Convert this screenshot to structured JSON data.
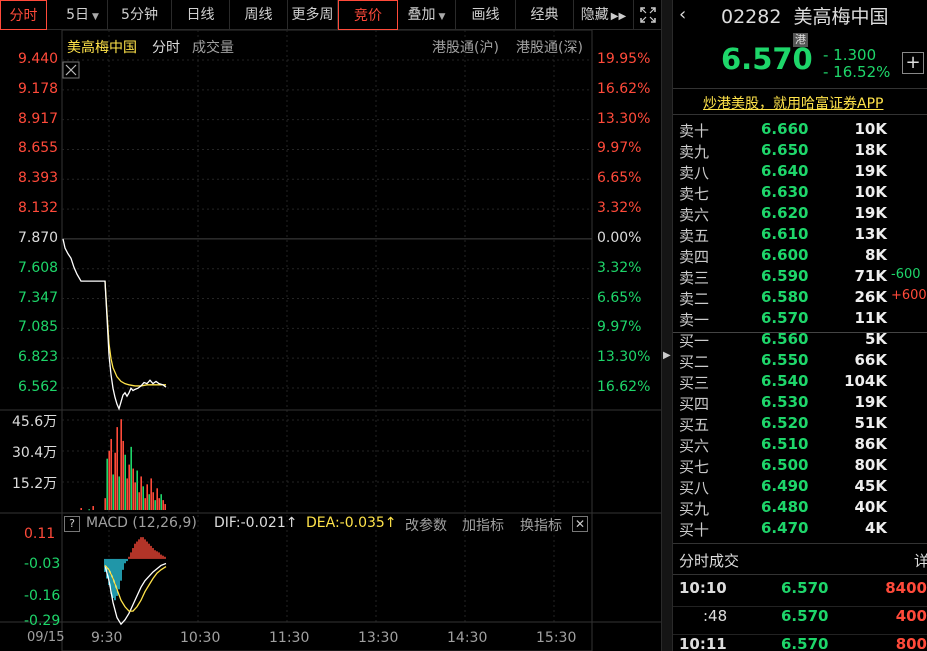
{
  "toolbar": {
    "tabs": [
      "分时",
      "5日",
      "5分钟",
      "日线",
      "周线",
      "更多周"
    ],
    "bidding": "竞价",
    "overlay": "叠加",
    "draw": "画线",
    "classic": "经典",
    "hide": "隐藏"
  },
  "chart": {
    "stock_name": "美高梅中国",
    "mode_label": "分时",
    "volume_label": "成交量",
    "connect_sh": "港股通(沪)",
    "connect_sz": "港股通(深)",
    "date": "09/15",
    "time_ticks": [
      "9:30",
      "10:30",
      "11:30",
      "13:30",
      "14:30",
      "15:30"
    ],
    "price_ticks": [
      "9.440",
      "9.178",
      "8.917",
      "8.655",
      "8.393",
      "8.132",
      "7.870",
      "7.608",
      "7.347",
      "7.085",
      "6.823",
      "6.562"
    ],
    "pct_ticks": [
      "19.95%",
      "16.62%",
      "13.30%",
      "9.97%",
      "6.65%",
      "3.32%",
      "0.00%",
      "3.32%",
      "6.65%",
      "9.97%",
      "13.30%",
      "16.62%"
    ],
    "volume_ticks": [
      "45.6万",
      "30.4万",
      "15.2万"
    ],
    "macd_label": "MACD (12,26,9)",
    "dif": "DIF:-0.021↑",
    "dea": "DEA:-0.035↑",
    "params": "改参数",
    "add_indicator": "加指标",
    "switch_indicator": "换指标",
    "macd_ticks": [
      "0.11",
      "-0.03",
      "-0.16",
      "-0.29"
    ]
  },
  "chart_data": {
    "type": "line",
    "price_line": [
      [
        0,
        7.87
      ],
      [
        2,
        7.79
      ],
      [
        5,
        7.74
      ],
      [
        8,
        7.7
      ],
      [
        11,
        7.62
      ],
      [
        14,
        7.56
      ],
      [
        18,
        7.5
      ],
      [
        22,
        7.5
      ],
      [
        26,
        7.5
      ],
      [
        30,
        7.5
      ],
      [
        34,
        7.5
      ],
      [
        38,
        7.5
      ],
      [
        42,
        7.5
      ],
      [
        44,
        7.18
      ],
      [
        46,
        6.85
      ],
      [
        48,
        6.68
      ],
      [
        50,
        6.56
      ],
      [
        52,
        6.48
      ],
      [
        54,
        6.42
      ],
      [
        56,
        6.38
      ],
      [
        58,
        6.44
      ],
      [
        60,
        6.5
      ],
      [
        62,
        6.52
      ],
      [
        64,
        6.49
      ],
      [
        66,
        6.52
      ],
      [
        68,
        6.56
      ],
      [
        70,
        6.54
      ],
      [
        72,
        6.55
      ],
      [
        75,
        6.56
      ],
      [
        78,
        6.58
      ],
      [
        81,
        6.61
      ],
      [
        84,
        6.6
      ],
      [
        87,
        6.63
      ],
      [
        90,
        6.6
      ],
      [
        93,
        6.62
      ],
      [
        96,
        6.6
      ],
      [
        100,
        6.59
      ],
      [
        103,
        6.57
      ]
    ],
    "avg_line": [
      [
        42,
        7.5
      ],
      [
        44,
        7.22
      ],
      [
        46,
        6.95
      ],
      [
        48,
        6.82
      ],
      [
        50,
        6.74
      ],
      [
        54,
        6.66
      ],
      [
        58,
        6.62
      ],
      [
        62,
        6.6
      ],
      [
        66,
        6.59
      ],
      [
        72,
        6.58
      ],
      [
        78,
        6.58
      ],
      [
        84,
        6.59
      ],
      [
        90,
        6.59
      ],
      [
        96,
        6.59
      ],
      [
        103,
        6.59
      ]
    ],
    "volumes": [
      [
        18,
        0.1
      ],
      [
        26,
        0.04
      ],
      [
        30,
        0.2
      ],
      [
        42,
        0.6
      ],
      [
        44,
        2.6
      ],
      [
        46,
        3.0
      ],
      [
        48,
        3.6
      ],
      [
        50,
        1.8
      ],
      [
        52,
        2.9
      ],
      [
        54,
        4.2
      ],
      [
        56,
        1.7
      ],
      [
        58,
        4.6
      ],
      [
        60,
        3.5
      ],
      [
        62,
        2.8
      ],
      [
        64,
        1.6
      ],
      [
        66,
        2.3
      ],
      [
        68,
        3.2
      ],
      [
        70,
        2.1
      ],
      [
        72,
        1.4
      ],
      [
        74,
        2.0
      ],
      [
        76,
        0.9
      ],
      [
        78,
        1.7
      ],
      [
        80,
        1.2
      ],
      [
        82,
        0.6
      ],
      [
        84,
        1.3
      ],
      [
        86,
        0.8
      ],
      [
        88,
        1.6
      ],
      [
        90,
        0.9
      ],
      [
        92,
        0.5
      ],
      [
        94,
        1.1
      ],
      [
        96,
        0.6
      ],
      [
        98,
        0.8
      ],
      [
        100,
        0.5
      ],
      [
        102,
        0.3
      ]
    ],
    "macd_bars": [
      [
        42,
        -0.06
      ],
      [
        44,
        -0.09
      ],
      [
        46,
        -0.12
      ],
      [
        48,
        -0.16
      ],
      [
        50,
        -0.18
      ],
      [
        52,
        -0.19
      ],
      [
        54,
        -0.17
      ],
      [
        56,
        -0.14
      ],
      [
        58,
        -0.1
      ],
      [
        60,
        -0.05
      ],
      [
        62,
        -0.02
      ],
      [
        64,
        -0.01
      ],
      [
        66,
        0.01
      ],
      [
        68,
        0.03
      ],
      [
        70,
        0.05
      ],
      [
        72,
        0.07
      ],
      [
        74,
        0.08
      ],
      [
        76,
        0.09
      ],
      [
        78,
        0.1
      ],
      [
        80,
        0.1
      ],
      [
        82,
        0.09
      ],
      [
        84,
        0.08
      ],
      [
        86,
        0.07
      ],
      [
        88,
        0.06
      ],
      [
        90,
        0.05
      ],
      [
        92,
        0.04
      ],
      [
        94,
        0.035
      ],
      [
        96,
        0.03
      ],
      [
        98,
        0.02
      ],
      [
        100,
        0.015
      ],
      [
        102,
        0.01
      ]
    ],
    "dif_line": [
      [
        42,
        -0.03
      ],
      [
        46,
        -0.1
      ],
      [
        50,
        -0.2
      ],
      [
        54,
        -0.27
      ],
      [
        58,
        -0.3
      ],
      [
        62,
        -0.28
      ],
      [
        66,
        -0.25
      ],
      [
        70,
        -0.21
      ],
      [
        74,
        -0.17
      ],
      [
        78,
        -0.13
      ],
      [
        82,
        -0.1
      ],
      [
        86,
        -0.08
      ],
      [
        90,
        -0.06
      ],
      [
        94,
        -0.045
      ],
      [
        98,
        -0.03
      ],
      [
        103,
        -0.021
      ]
    ],
    "dea_line": [
      [
        42,
        -0.03
      ],
      [
        46,
        -0.05
      ],
      [
        50,
        -0.09
      ],
      [
        54,
        -0.14
      ],
      [
        58,
        -0.19
      ],
      [
        62,
        -0.22
      ],
      [
        66,
        -0.24
      ],
      [
        70,
        -0.24
      ],
      [
        74,
        -0.22
      ],
      [
        78,
        -0.19
      ],
      [
        82,
        -0.15
      ],
      [
        86,
        -0.12
      ],
      [
        90,
        -0.09
      ],
      [
        94,
        -0.065
      ],
      [
        98,
        -0.05
      ],
      [
        103,
        -0.035
      ]
    ],
    "price_range": [
      6.562,
      9.44
    ],
    "volume_max": 4.56,
    "macd_range": [
      -0.29,
      0.11
    ]
  },
  "quote": {
    "code": "02282",
    "name": "美高梅中国",
    "market_badge": "港",
    "price": "6.570",
    "change": "- 1.300",
    "change_pct": "- 16.52%",
    "plus": "+",
    "ad": "炒港美股，就用哈富证券APP"
  },
  "orderbook": {
    "asks": [
      {
        "label": "卖十",
        "price": "6.660",
        "vol": "10K",
        "delta": ""
      },
      {
        "label": "卖九",
        "price": "6.650",
        "vol": "18K",
        "delta": ""
      },
      {
        "label": "卖八",
        "price": "6.640",
        "vol": "19K",
        "delta": ""
      },
      {
        "label": "卖七",
        "price": "6.630",
        "vol": "10K",
        "delta": ""
      },
      {
        "label": "卖六",
        "price": "6.620",
        "vol": "19K",
        "delta": ""
      },
      {
        "label": "卖五",
        "price": "6.610",
        "vol": "13K",
        "delta": ""
      },
      {
        "label": "卖四",
        "price": "6.600",
        "vol": "8K",
        "delta": ""
      },
      {
        "label": "卖三",
        "price": "6.590",
        "vol": "71K",
        "delta": "-600"
      },
      {
        "label": "卖二",
        "price": "6.580",
        "vol": "26K",
        "delta": "+600"
      },
      {
        "label": "卖一",
        "price": "6.570",
        "vol": "11K",
        "delta": ""
      }
    ],
    "bids": [
      {
        "label": "买一",
        "price": "6.560",
        "vol": "5K"
      },
      {
        "label": "买二",
        "price": "6.550",
        "vol": "66K"
      },
      {
        "label": "买三",
        "price": "6.540",
        "vol": "104K"
      },
      {
        "label": "买四",
        "price": "6.530",
        "vol": "19K"
      },
      {
        "label": "买五",
        "price": "6.520",
        "vol": "51K"
      },
      {
        "label": "买六",
        "price": "6.510",
        "vol": "86K"
      },
      {
        "label": "买七",
        "price": "6.500",
        "vol": "80K"
      },
      {
        "label": "买八",
        "price": "6.490",
        "vol": "45K"
      },
      {
        "label": "买九",
        "price": "6.480",
        "vol": "40K"
      },
      {
        "label": "买十",
        "price": "6.470",
        "vol": "4K"
      }
    ]
  },
  "trades": {
    "title": "分时成交",
    "detail": "详",
    "rows": [
      {
        "time": "10:10",
        "price": "6.570",
        "vol": "8400"
      },
      {
        "time": ":48",
        "price": "6.570",
        "vol": "400"
      },
      {
        "time": "10:11",
        "price": "6.570",
        "vol": "800"
      }
    ]
  },
  "colors": {
    "up": "#ff4a3a",
    "down": "#1ed66a",
    "avg": "#ffe34a",
    "line": "#ffffff"
  }
}
